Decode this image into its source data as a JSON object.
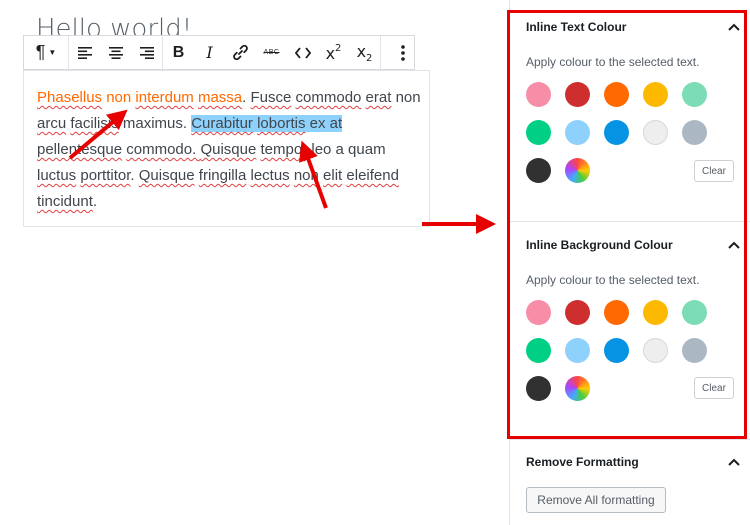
{
  "editor": {
    "post_title": "Hello world!",
    "paragraph": {
      "s1": "Phasellus",
      "s2": "non",
      "s3": "interdum",
      "s4": "massa",
      "s5": ". ",
      "s6": "Fusce",
      "s7": "commodo",
      "s8": "erat",
      "s9": "non",
      "s10": "arcu",
      "s11": "facilisis",
      "s12": "maximus. ",
      "s13": "Curabitur",
      "s14": "lobortis",
      "s15": "ex at",
      "s16": "pellentesque",
      "s17": "commodo. ",
      "s18": "Quisque",
      "s19": "tempor",
      "s20": "leo a quam",
      "s21": "luctus",
      "s22": "porttitor",
      "s23": ". ",
      "s24": "Quisque",
      "s25": "fringilla",
      "s26": "lectus",
      "s27": "non",
      "s28": "elit",
      "s29": "eleifend",
      "s30": "tincidunt",
      "s31": "."
    }
  },
  "toolbar": {
    "icons": [
      "paragraph-icon",
      "align-left-icon",
      "align-center-icon",
      "align-right-icon",
      "bold-icon",
      "italic-icon",
      "link-icon",
      "strikethrough-icon",
      "code-icon",
      "superscript-icon",
      "subscript-icon",
      "more-options-icon"
    ],
    "paragraph_glyph": "¶",
    "bold_glyph": "B",
    "italic_glyph": "I",
    "strike_glyph": "ABC",
    "superscript_base": "x",
    "superscript_mark": "2",
    "subscript_base": "x",
    "subscript_mark": "2"
  },
  "sidebar": {
    "text_colour": {
      "title": "Inline Text Colour",
      "description": "Apply colour to the selected text.",
      "clear_label": "Clear"
    },
    "background_colour": {
      "title": "Inline Background Colour",
      "description": "Apply colour to the selected text.",
      "clear_label": "Clear"
    },
    "remove_formatting": {
      "title": "Remove Formatting",
      "button_label": "Remove All formatting"
    }
  },
  "colors": {
    "swatches": [
      "#f78da7",
      "#cf2e2e",
      "#ff6900",
      "#fcb900",
      "#7bdcb5",
      "#00d084",
      "#8ed1fc",
      "#0693e3",
      "#eeeeee",
      "#abb8c3",
      "#313131",
      "gradient"
    ],
    "accent_orange": "#ff6900",
    "selection_highlight": "#8ed1fc",
    "annotation_red": "#e60000"
  }
}
